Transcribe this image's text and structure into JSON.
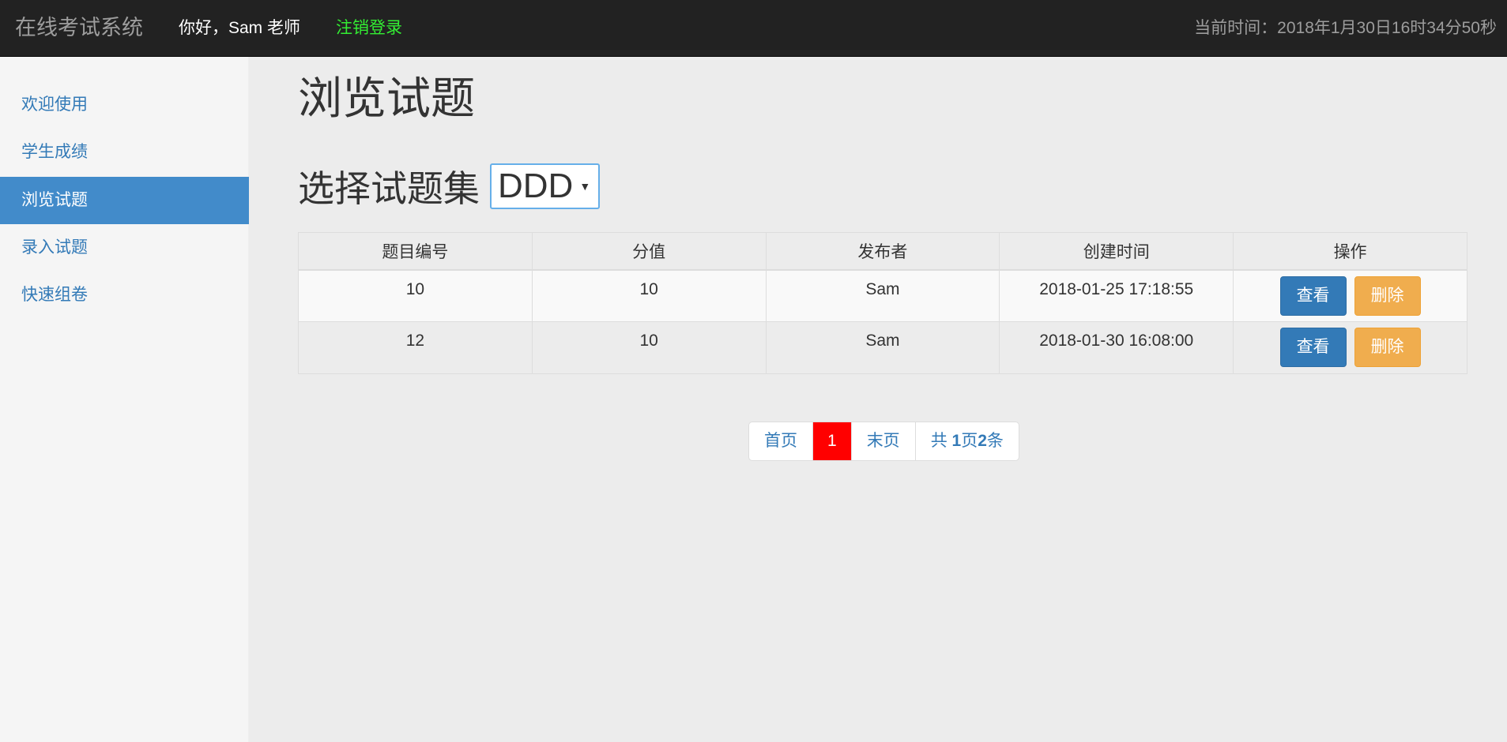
{
  "header": {
    "brand": "在线考试系统",
    "greeting": "你好，Sam 老师",
    "logout_label": "注销登录",
    "clock": "当前时间：2018年1月30日16时34分50秒"
  },
  "sidebar": {
    "items": [
      {
        "label": "欢迎使用",
        "active": false
      },
      {
        "label": "学生成绩",
        "active": false
      },
      {
        "label": "浏览试题",
        "active": true
      },
      {
        "label": "录入试题",
        "active": false
      },
      {
        "label": "快速组卷",
        "active": false
      }
    ]
  },
  "main": {
    "title": "浏览试题",
    "set_label": "选择试题集",
    "set_selected": "DDD"
  },
  "table": {
    "columns": [
      "题目编号",
      "分值",
      "发布者",
      "创建时间",
      "操作"
    ],
    "rows": [
      {
        "id": "10",
        "score": "10",
        "publisher": "Sam",
        "created": "2018-01-25 17:18:55"
      },
      {
        "id": "12",
        "score": "10",
        "publisher": "Sam",
        "created": "2018-01-30 16:08:00"
      }
    ],
    "view_label": "查看",
    "delete_label": "删除"
  },
  "pagination": {
    "first_label": "首页",
    "current_page": "1",
    "last_label": "末页",
    "info_prefix": "共 ",
    "total_pages": "1",
    "info_mid": "页",
    "total_items": "2",
    "info_suffix": "条"
  }
}
